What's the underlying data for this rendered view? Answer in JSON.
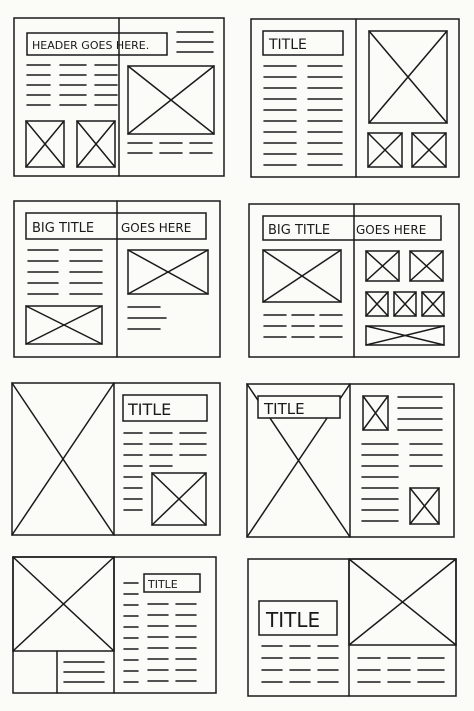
{
  "colors": {
    "ink": "#1a1a1a",
    "paper": "#fbfbf8"
  },
  "spreads": [
    {
      "title": "HEADER GOES HERE."
    },
    {
      "title": "TITLE"
    },
    {
      "title_left": "BIG TITLE",
      "title_right": "GOES HERE"
    },
    {
      "title_left": "BIG TITLE",
      "title_right": "GOES HERE"
    },
    {
      "title": "TITLE"
    },
    {
      "title": "TITLE"
    },
    {
      "title": "TITLE"
    },
    {
      "title": "TITLE"
    }
  ]
}
